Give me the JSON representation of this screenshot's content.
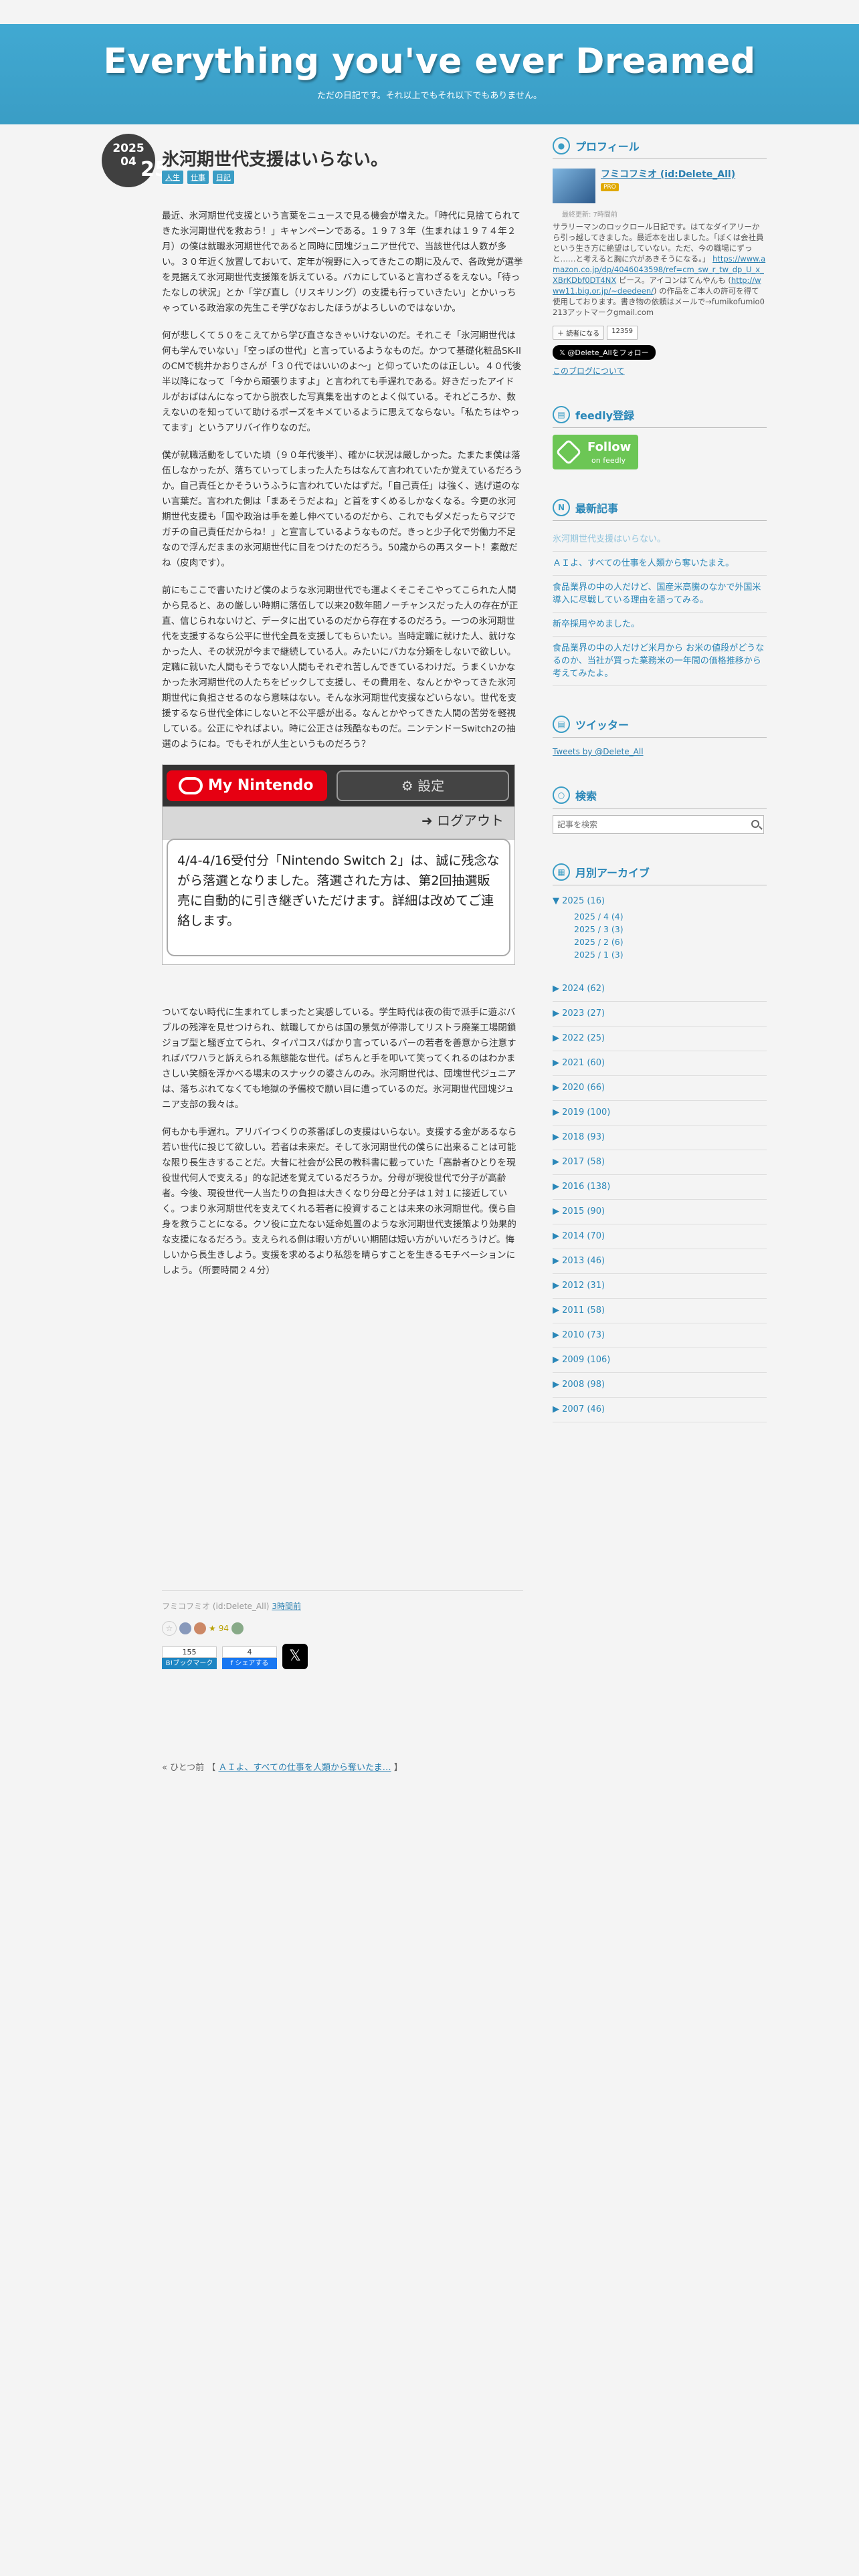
{
  "header": {
    "title": "Everything you've ever Dreamed",
    "description": "ただの日記です。それ以上でもそれ以下でもありません。"
  },
  "entry": {
    "date": {
      "year": "2025",
      "month": "04",
      "day": "25"
    },
    "title": "氷河期世代支援はいらない。",
    "categories": [
      "人生",
      "仕事",
      "日記"
    ],
    "paragraphs": [
      "最近、氷河期世代支援という言葉をニュースで見る機会が増えた。「時代に見捨てられてきた氷河期世代を救おう！」キャンペーンである。１９７３年（生まれは１９７４年２月）の僕は就職氷河期世代であると同時に団塊ジュニア世代で、当該世代は人数が多い。３０年近く放置しておいて、定年が視野に入ってきたこの期に及んで、各政党が選挙を見据えて氷河期世代支援策を訴えている。バカにしていると言わざるをえない。「待ったなしの状況」とか「学び直し（リスキリング）の支援も行っていきたい」とかいっちゃっている政治家の先生こそ学びなおしたほうがよろしいのではないか。",
      "何が悲しくて５０をこえてから学び直さなきゃいけないのだ。それこそ「氷河期世代は何も学んでいない」「空っぽの世代」と言っているようなものだ。かつて基礎化粧品SK-IIのCMで桃井かおりさんが「３０代ではいいのよ～」と仰っていたのは正しい。４０代後半以降になって「今から頑張りますよ」と言われても手遅れである。好きだったアイドルがおばはんになってから脱衣した写真集を出すのとよく似ている。それどころか、数えないのを知っていて助けるポーズをキメているように思えてならない。「私たちはやってます」というアリバイ作りなのだ。",
      "僕が就職活動をしていた頃（９０年代後半）、確かに状況は厳しかった。たまたま僕は落伍しなかったが、落ちていってしまった人たちはなんて言われていたか覚えているだろうか。自己責任とかそういうふうに言われていたはずだ。「自己責任」は強く、逃げ道のない言葉だ。言われた側は「まあそうだよね」と首をすくめるしかなくなる。今更の氷河期世代支援も「国や政治は手を差し伸べているのだから、これでもダメだったらマジでガチの自己責任だからね！」と宣言しているようなものだ。きっと少子化で労働力不足なので浮んだままの氷河期世代に目をつけたのだろう。50歳からの再スタート！素敵だね（皮肉です）。",
      "前にもここで書いたけど僕のような氷河期世代でも運よくそこそこやってこられた人間から見ると、あの厳しい時期に落伍して以来20数年間ノーチャンスだった人の存在が正直、信じられないけど、データに出ているのだから存在するのだろう。一つの氷河期世代を支援するなら公平に世代全員を支援してもらいたい。当時定職に就けた人、就けなかった人、その状況が今まで継続している人。みたいにバカな分類をしないで欲しい。定職に就いた人間もそうでない人間もそれぞれ苦しんできているわけだ。うまくいかなかった氷河期世代の人たちをピックして支援し、その費用を、なんとかやってきた氷河期世代に負担させるのなら意味はない。そんな氷河期世代支援などいらない。世代を支援するなら世代全体にしないと不公平感が出る。なんとかやってきた人間の苦労を軽視している。公正にやればよい。時に公正さは残酷なものだ。ニンテンドーSwitch2の抽選のようにね。でもそれが人生というものだろう？",
      "ついてない時代に生まれてしまったと実感している。学生時代は夜の街で派手に遊ぶバブルの残滓を見せつけられ、就職してからは国の景気が停滞してリストラ廃業工場閉鎖ジョブ型と騒ぎ立てられ、タイパコスパばかり言っているバーの若者を善意から注意すればパワハラと訴えられる無態能な世代。ぱちんと手を叩いて笑ってくれるのはわかまさしい笑顔を浮かべる場末のスナックの婆さんのみ。氷河期世代は、団塊世代ジュニアは、落ちぶれてなくても地獄の予備校で願い目に遭っているのだ。氷河期世代団塊ジュニア支部の我々は。",
      "何もかも手遅れ。アリバイつくりの茶番ぽしの支援はいらない。支援する金があるなら若い世代に投じて欲しい。若者は未来だ。そして氷河期世代の僕らに出来ることは可能な限り長生きすることだ。大昔に社会が公民の教科書に載っていた「高齢者ひとりを現役世代何人で支える」的な記述を覚えているだろうか。分母が現役世代で分子が高齢者。今後、現役世代一人当たりの負担は大きくなり分母と分子は１対１に接近していく。つまり氷河期世代を支えてくれる若者に投資することは未来の氷河期世代。僕ら自身を救うことになる。クソ役に立たない延命処置のような氷河期世代支援策より効果的な支援になるだろう。支えられる側は暇い方がいい期間は短い方がいいだろうけど。悔しいから長生きしよう。支援を求めるより私怨を晴らすことを生きるモチベーションにしよう。（所要時間２４分）"
    ],
    "screenshot": {
      "brand": "My Nintendo",
      "settings": "設定",
      "logout": "ログアウト",
      "message": "4/4-4/16受付分「Nintendo Switch 2」は、誠に残念ながら落選となりました。落選された方は、第2回抽選販売に自動的に引き継ぎいただけます。詳細は改めてご連絡します。"
    },
    "author_line": "フミコフミオ (id:Delete_All)",
    "time_ago": "3時間前",
    "star_count": "94",
    "bookmark_count": "155",
    "bookmark_label": "B!ブックマーク",
    "facebook_count": "4",
    "facebook_label": "f シェアする"
  },
  "pager": {
    "prefix": "« ひとつ前",
    "link": "ＡＩよ、すべての仕事を人類から奪いたま…"
  },
  "sidebar": {
    "profile": {
      "heading": "プロフィール",
      "name": "フミコフミオ (id:Delete_All)",
      "pro": "PRO",
      "last_seen": "最終更新: 7時間前",
      "text": "サラリーマンのロックロール日記です。はてなダイアリーから引っ越してきました。最近本を出しました。「ぼくは会社員という生き方に絶望はしていない。ただ、今の職場にずっと……と考えると胸に穴があきそうになる。」",
      "amazon": "https://www.amazon.co.jp/dp/4046043598/ref=cm_sw_r_tw_dp_U_x_XBrKDbf0DT4NX",
      "amazon_suffix": "ピース。アイコンはてんやんも",
      "link": "http://www11.big.or.jp/~deedeen/",
      "contact": "の作品をご本人の許可を得て使用しております。書き物の依頼はメールで→fumikofumio0213アットマークgmail.com",
      "reader_label": "読者になる",
      "reader_count": "12359",
      "follow": "𝕏 @Delete_Allをフォロー",
      "about": "このブログについて"
    },
    "feedly": {
      "heading": "feedly登録",
      "follow": "Follow",
      "on": "on feedly"
    },
    "recent": {
      "heading": "最新記事",
      "items": [
        "氷河期世代支援はいらない。",
        "ＡＩよ、すべての仕事を人類から奪いたまえ。",
        "食品業界の中の人だけど、国産米高騰のなかで外国米導入に尽戦している理由を語ってみる。",
        "新卒採用やめました。",
        "食品業界の中の人だけど米月から お米の値段がどうなるのか、当社が買った業務米の一年間の価格推移から考えてみたよ。"
      ]
    },
    "twitter": {
      "heading": "ツイッター",
      "link": "Tweets by @Delete_All"
    },
    "search": {
      "heading": "検索",
      "placeholder": "記事を検索"
    },
    "archive": {
      "heading": "月別アーカイブ",
      "open_year": "▼ 2025 (16)",
      "months": [
        "2025 / 4 (4)",
        "2025 / 3 (3)",
        "2025 / 2 (6)",
        "2025 / 1 (3)"
      ],
      "years": [
        "▶ 2024 (62)",
        "▶ 2023 (27)",
        "▶ 2022 (25)",
        "▶ 2021 (60)",
        "▶ 2020 (66)",
        "▶ 2019 (100)",
        "▶ 2018 (93)",
        "▶ 2017 (58)",
        "▶ 2016 (138)",
        "▶ 2015 (90)",
        "▶ 2014 (70)",
        "▶ 2013 (46)",
        "▶ 2012 (31)",
        "▶ 2011 (58)",
        "▶ 2010 (73)",
        "▶ 2009 (106)",
        "▶ 2008 (98)",
        "▶ 2007 (46)"
      ]
    }
  }
}
